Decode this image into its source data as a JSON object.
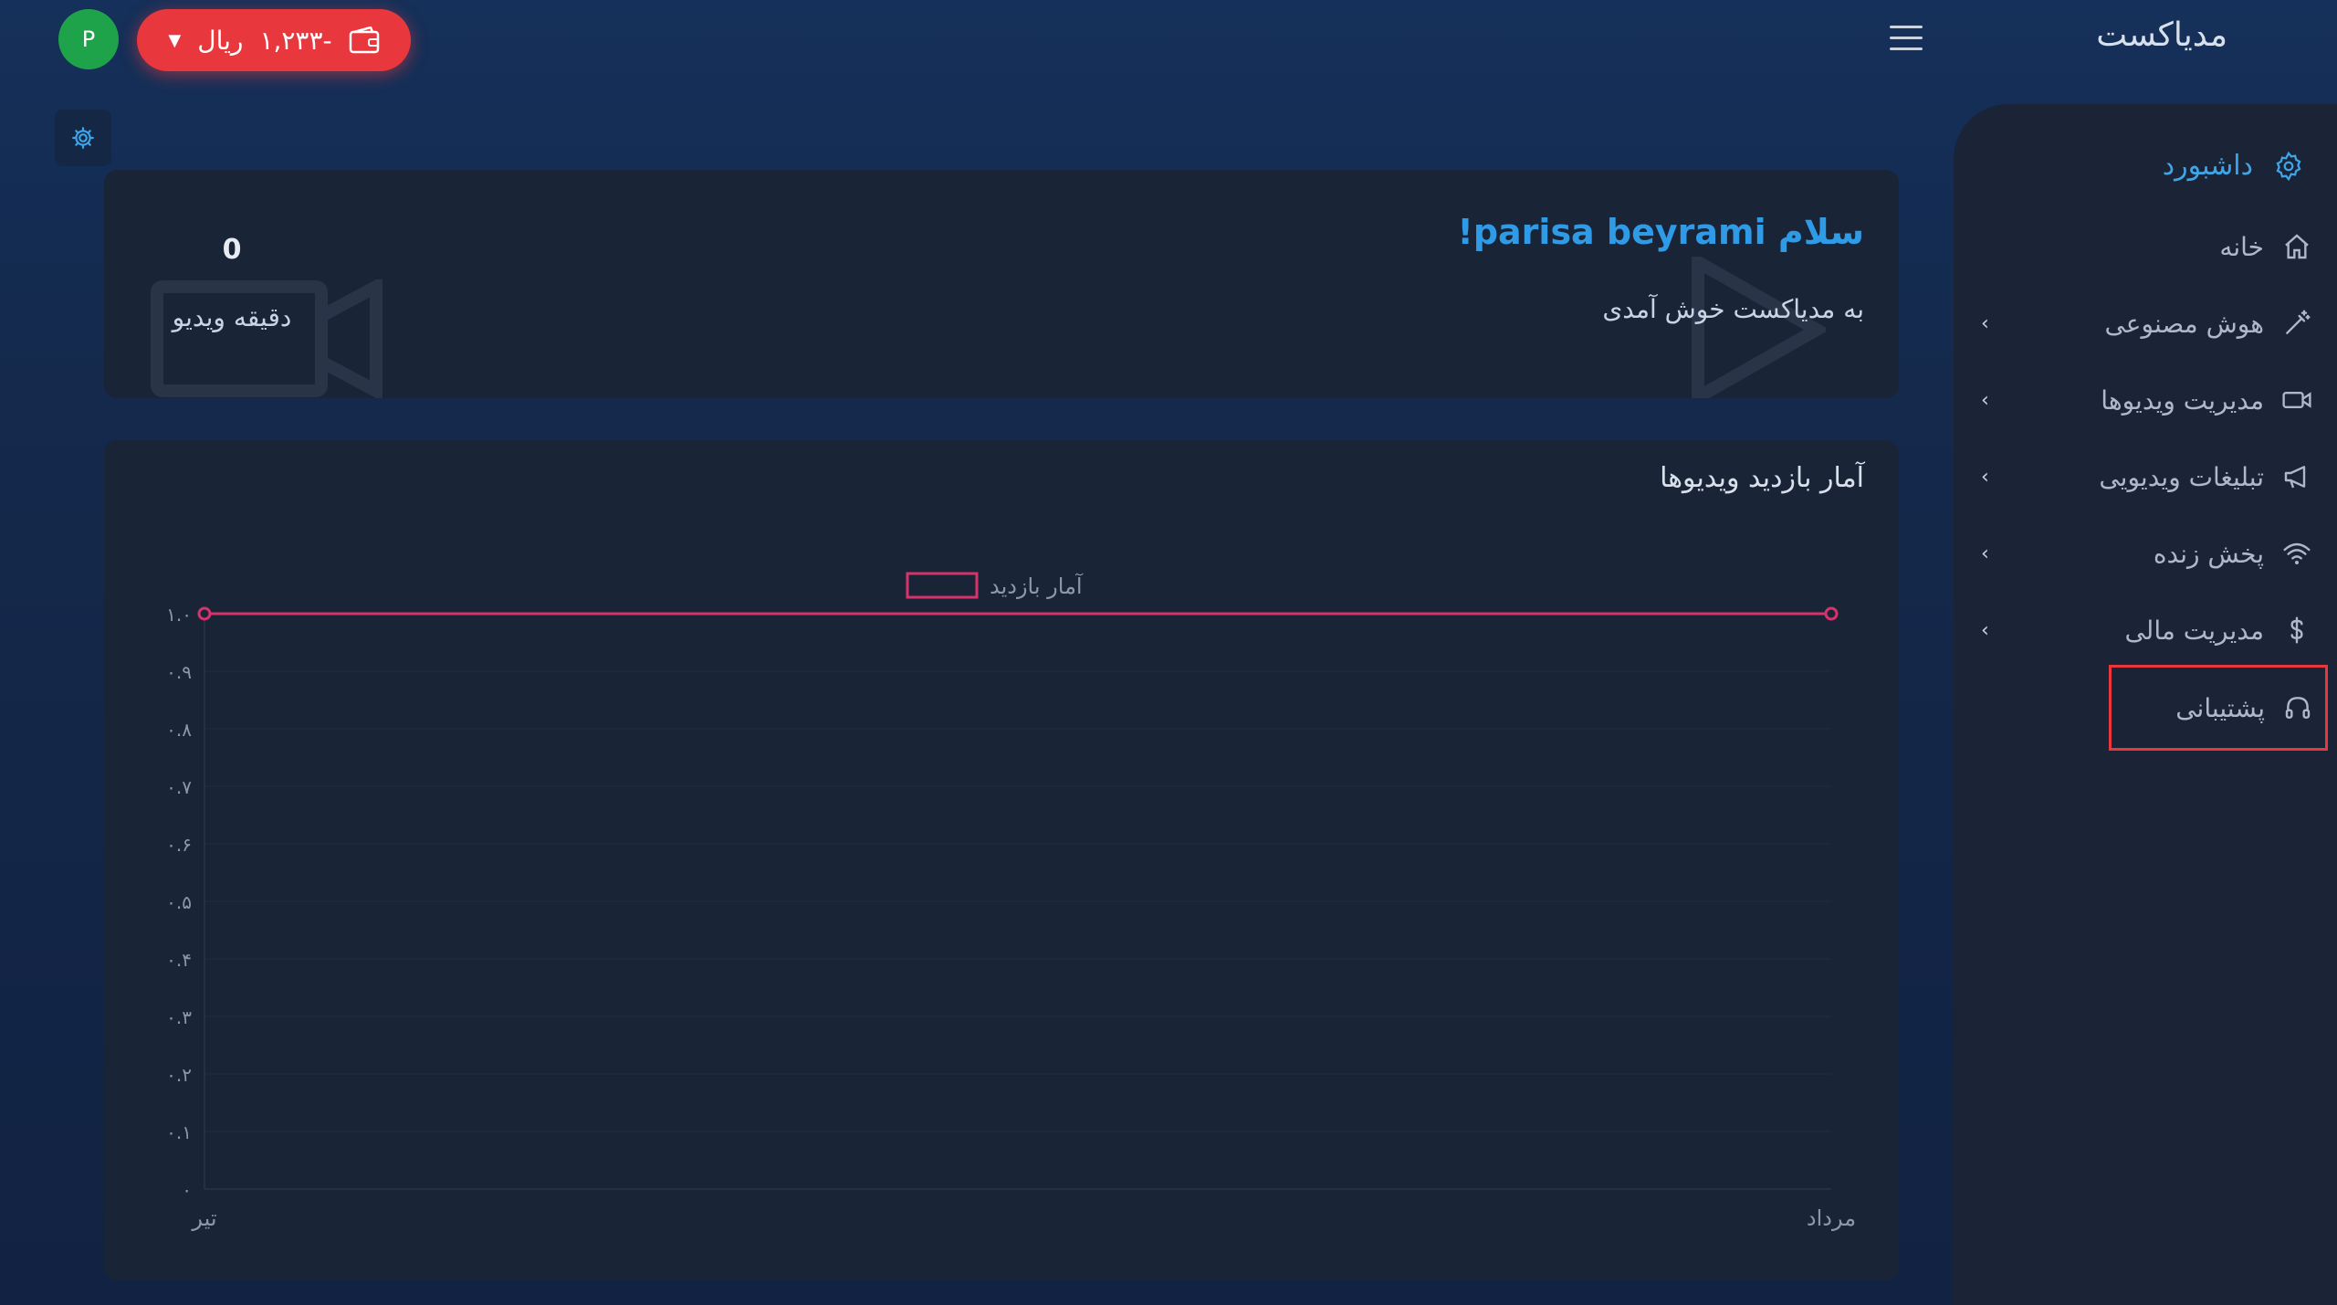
{
  "header": {
    "app_title": "مدیاکست",
    "avatar_letter": "P",
    "wallet_amount": "-۱,۲۳۳",
    "wallet_currency": "ریال",
    "wallet_icon": "wallet-icon",
    "menu_icon": "hamburger-icon"
  },
  "settings_icon": "gear-icon",
  "sidebar": {
    "dashboard_label": "داشبورد",
    "items": [
      {
        "label": "خانه",
        "icon": "home-icon",
        "has_children": false
      },
      {
        "label": "هوش مصنوعی",
        "icon": "magic-wand-icon",
        "has_children": true
      },
      {
        "label": "مدیریت ویدیوها",
        "icon": "video-camera-icon",
        "has_children": true
      },
      {
        "label": "تبلیغات ویدیویی",
        "icon": "megaphone-icon",
        "has_children": true
      },
      {
        "label": "پخش زنده",
        "icon": "wifi-icon",
        "has_children": true
      },
      {
        "label": "مدیریت مالی",
        "icon": "dollar-icon",
        "has_children": true
      },
      {
        "label": "پشتیبانی",
        "icon": "headphones-icon",
        "has_children": false,
        "selected": true
      }
    ]
  },
  "welcome": {
    "greeting": "سلام parisa beyrami!",
    "subtitle": "به مدیاکست خوش آمدی",
    "video_minutes_value": "0",
    "video_minutes_label": "دقیقه ویدیو"
  },
  "chart_section": {
    "title": "آمار بازدید ویدیوها"
  },
  "chart_data": {
    "type": "line",
    "categories": [
      "تیر",
      "مرداد"
    ],
    "series": [
      {
        "name": "آمار بازدید",
        "values": [
          1.0,
          1.0
        ],
        "color": "#d6336c"
      }
    ],
    "ylim": [
      0,
      1.0
    ],
    "y_ticks": [
      "۰",
      "۰.۱",
      "۰.۲",
      "۰.۳",
      "۰.۴",
      "۰.۵",
      "۰.۶",
      "۰.۷",
      "۰.۸",
      "۰.۹",
      "۱.۰"
    ],
    "legend_position": "top-center",
    "grid": true
  }
}
